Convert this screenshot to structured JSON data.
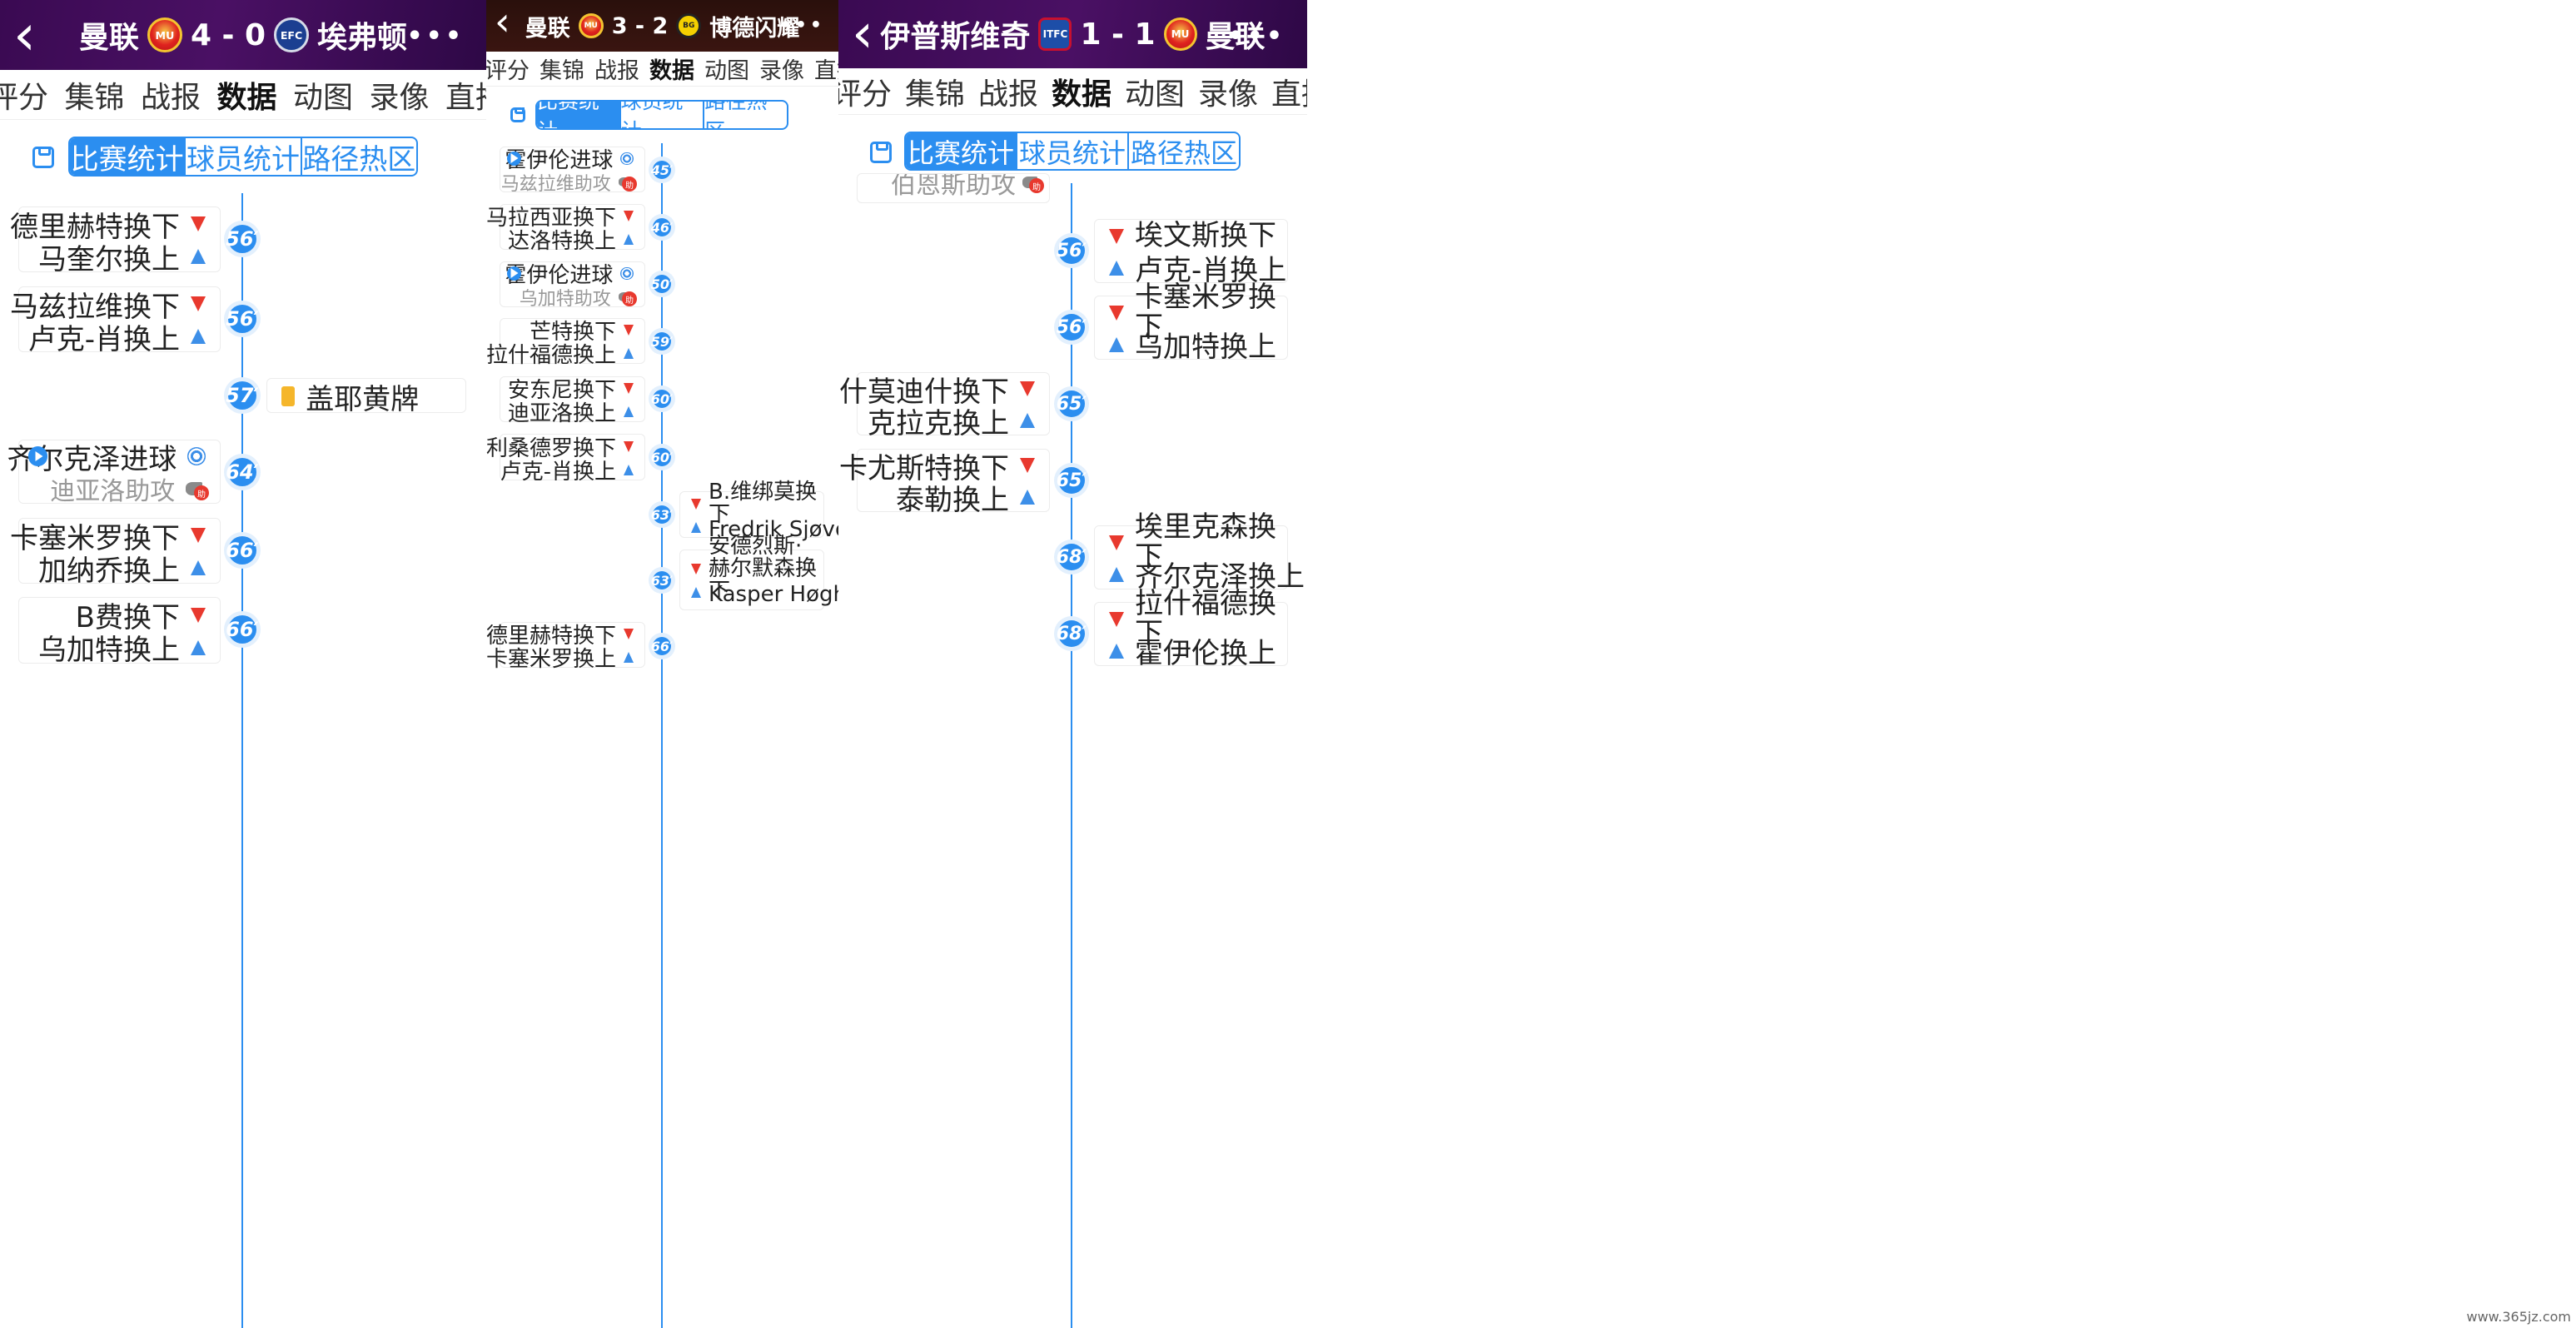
{
  "panels": [
    {
      "header": {
        "home": "曼联",
        "score": "4 - 0",
        "away": "埃弗顿",
        "home_crest": "MU",
        "away_crest": "EFC",
        "back": "‹",
        "more": "•••"
      },
      "tabs": [
        "评分",
        "集锦",
        "战报",
        "数据",
        "动图",
        "录像",
        "直播"
      ],
      "active_tab": "数据",
      "segments": [
        "比赛统计",
        "球员统计",
        "路径热区"
      ],
      "events": [
        {
          "side": "left",
          "minute": "56′",
          "l1": "德里赫特换下",
          "l2": "马奎尔换上",
          "type": "sub"
        },
        {
          "side": "left",
          "minute": "56′",
          "l1": "马兹拉维换下",
          "l2": "卢克-肖换上",
          "type": "sub"
        },
        {
          "side": "right",
          "minute": "57′",
          "l1": "盖耶黄牌",
          "type": "yellow"
        },
        {
          "side": "left",
          "minute": "64′",
          "l1": "齐尔克泽进球",
          "l2": "迪亚洛助攻",
          "type": "goal"
        },
        {
          "side": "left",
          "minute": "66′",
          "l1": "卡塞米罗换下",
          "l2": "加纳乔换上",
          "type": "sub"
        },
        {
          "side": "left",
          "minute": "66′",
          "l1": "B费换下",
          "l2": "乌加特换上",
          "type": "sub"
        }
      ]
    },
    {
      "header": {
        "home": "曼联",
        "score": "3 - 2",
        "away": "博德闪耀",
        "home_crest": "MU",
        "away_crest": "BG",
        "back": "‹",
        "more": "•••"
      },
      "tabs": [
        "评分",
        "集锦",
        "战报",
        "数据",
        "动图",
        "录像",
        "直播"
      ],
      "active_tab": "数据",
      "segments": [
        "比赛统计",
        "球员统计",
        "路径热区"
      ],
      "events": [
        {
          "side": "left",
          "minute": "45′",
          "l1": "霍伊伦进球",
          "l2": "马兹拉维助攻",
          "type": "goal"
        },
        {
          "side": "left",
          "minute": "46′",
          "l1": "马拉西亚换下",
          "l2": "达洛特换上",
          "type": "sub"
        },
        {
          "side": "left",
          "minute": "50′",
          "l1": "霍伊伦进球",
          "l2": "乌加特助攻",
          "type": "goal"
        },
        {
          "side": "left",
          "minute": "59′",
          "l1": "芒特换下",
          "l2": "拉什福德换上",
          "type": "sub"
        },
        {
          "side": "left",
          "minute": "60′",
          "l1": "安东尼换下",
          "l2": "迪亚洛换上",
          "type": "sub"
        },
        {
          "side": "left",
          "minute": "60′",
          "l1": "利桑德罗换下",
          "l2": "卢克-肖换上",
          "type": "sub"
        },
        {
          "side": "right",
          "minute": "63′",
          "l1": "B.维绑莫换下",
          "l2": "Fredrik Sjøvold换上",
          "type": "sub"
        },
        {
          "side": "right",
          "minute": "63′",
          "l1": "安德烈斯·赫尔默森换下",
          "l2": "Kasper Høgh换上",
          "type": "sub"
        },
        {
          "side": "left",
          "minute": "66′",
          "l1": "德里赫特换下",
          "l2": "卡塞米罗换上",
          "type": "sub"
        }
      ]
    },
    {
      "header": {
        "home": "伊普斯维奇",
        "score": "1 - 1",
        "away": "曼联",
        "home_crest": "ITFC",
        "away_crest": "MU",
        "back": "‹",
        "more": "•••"
      },
      "tabs": [
        "评分",
        "集锦",
        "战报",
        "数据",
        "动图",
        "录像",
        "直播"
      ],
      "active_tab": "数据",
      "segments": [
        "比赛统计",
        "球员统计",
        "路径热区"
      ],
      "partial_text": "伯恩斯助攻",
      "events": [
        {
          "side": "right",
          "minute": "56′",
          "l1": "埃文斯换下",
          "l2": "卢克-肖换上",
          "type": "sub"
        },
        {
          "side": "right",
          "minute": "56′",
          "l1": "卡塞米罗换下",
          "l2": "乌加特换上",
          "type": "sub"
        },
        {
          "side": "left",
          "minute": "65′",
          "l1": "什莫迪什换下",
          "l2": "克拉克换上",
          "type": "sub"
        },
        {
          "side": "left",
          "minute": "65′",
          "l1": "卡尤斯特换下",
          "l2": "泰勒换上",
          "type": "sub"
        },
        {
          "side": "right",
          "minute": "68′",
          "l1": "埃里克森换下",
          "l2": "齐尔克泽换上",
          "type": "sub"
        },
        {
          "side": "right",
          "minute": "68′",
          "l1": "拉什福德换下",
          "l2": "霍伊伦换上",
          "type": "sub"
        }
      ]
    }
  ],
  "watermark": "www.365jz.com",
  "colors": {
    "accent": "#2b8ef0",
    "down": "#e8392e",
    "up": "#3d8fe8",
    "yellow": "#f5b62b",
    "header_purple": "#3b0b52",
    "header_dark": "#2a0f0b"
  }
}
